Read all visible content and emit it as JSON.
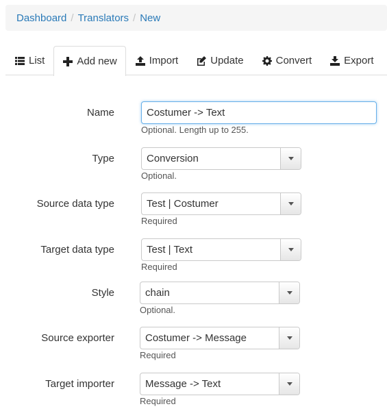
{
  "breadcrumb": {
    "items": [
      "Dashboard",
      "Translators",
      "New"
    ],
    "separator": "/"
  },
  "tabs": [
    {
      "label": "List",
      "icon": "list-icon"
    },
    {
      "label": "Add new",
      "icon": "plus-icon"
    },
    {
      "label": "Import",
      "icon": "upload-icon"
    },
    {
      "label": "Update",
      "icon": "edit-icon"
    },
    {
      "label": "Convert",
      "icon": "gear-icon"
    },
    {
      "label": "Export",
      "icon": "download-icon"
    }
  ],
  "form": {
    "name": {
      "label": "Name",
      "value": "Costumer -> Text",
      "help": "Optional. Length up to 255."
    },
    "type": {
      "label": "Type",
      "value": "Conversion",
      "help": "Optional."
    },
    "source_data_type": {
      "label": "Source data type",
      "value": "Test | Costumer",
      "help": "Required"
    },
    "target_data_type": {
      "label": "Target data type",
      "value": "Test | Text",
      "help": "Required"
    },
    "style": {
      "label": "Style",
      "value": "chain",
      "help": "Optional."
    },
    "source_exporter": {
      "label": "Source exporter",
      "value": "Costumer -> Message",
      "help": "Required"
    },
    "target_importer": {
      "label": "Target importer",
      "value": "Message -> Text",
      "help": "Required"
    }
  },
  "colors": {
    "link": "#2a7ab8",
    "focus_border": "#66afe9",
    "breadcrumb_bg": "#f5f5f5"
  }
}
